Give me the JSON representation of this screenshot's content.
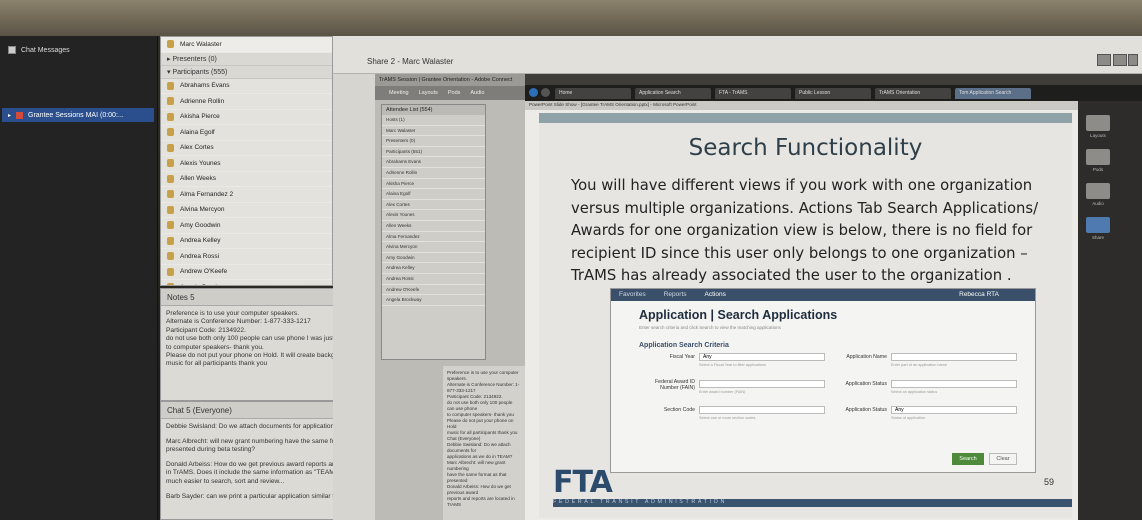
{
  "left_panel": {
    "chat_messages_label": "Chat Messages",
    "session_label": "Grantee Sessions MAI (0:00:..."
  },
  "participants": {
    "presenter": "Marc Walaster",
    "presenters_header": "Presenters (0)",
    "participants_header": "Participants (555)",
    "items": [
      "Abrahams Evans",
      "Adrienne Rollin",
      "Akisha Pierce",
      "Alaina Egolf",
      "Alex Cortes",
      "Alexis Younes",
      "Allen Weeks",
      "Alma Fernandez 2",
      "Alvina Mercyon",
      "Amy Goodwin",
      "Andrea Kelley",
      "Andrea Rossi",
      "Andrew O'Keefe",
      "Angela Brockway"
    ]
  },
  "notes": {
    "title": "Notes 5",
    "lines": [
      "Preference is to use your computer speakers.",
      "Alternate is Conference Number: 1-877-333-1217",
      "Participant Code: 2134922.",
      "do not use both only 100 people can use phone I was just informed",
      "to computer speakers- thank you.",
      "Please do not put your phone on Hold. It will create background",
      "music for all participants thank you"
    ]
  },
  "chat": {
    "title": "Chat 5 (Everyone)",
    "messages": [
      "Debbie Swisland: Do we attach documents for applications as we do in TEAM?",
      "Marc Albrecht: will new grant numbering have the same format as that presented during beta testing?",
      "Donald Arbeiss: How do we get previous award reports and reports are located in TrAMS. Does it include the same information as \"TEAM\" it appears to be much easier to search, sort and review...",
      "Barb Sayder: can we print a particular application similar to \"TEAM"
    ]
  },
  "share": {
    "title": "Share 2 - Marc Walaster"
  },
  "inner_app": {
    "window_title": "TrAMS Session | Grantee Orientation - Adobe Connect",
    "toolbar": [
      "Meeting",
      "Layouts",
      "Pods",
      "Audio"
    ],
    "list_title": "Attendee List (554)",
    "list_items": [
      "Hosts (1)",
      "Marc Walaster",
      "Presenters (0)",
      "Participants (551)",
      "Abrahams Evans",
      "Adrienne Rollin",
      "Akisha Pierce",
      "Alaina Egolf",
      "Alex Cortes",
      "Alexis Younes",
      "Allen Weeks",
      "Alma Fernandez",
      "Alvina Mercyon",
      "Amy Goodwin",
      "Andrea Kelley",
      "Andrea Rossi",
      "Andrew O'Keefe",
      "Angela Brockway"
    ],
    "chat_lines": [
      "Preference is to use your computer speakers.",
      "Alternate is Conference Number: 1-877-333-1217",
      "Participant Code: 2134922.",
      "do not use both only 100 people can use phone",
      "to computer speakers- thank you",
      "Please do not put your phone on Hold",
      "music for all participants thank you",
      "",
      "Chat (Everyone)",
      "Debbie Swisland: Do we attach documents for",
      "applications as we do in TEAM?",
      "Marc Albrecht: will new grant numbering",
      "have the same format as that presented",
      "Donald Arbeiss: How do we get previous award",
      "reports and reports are located in TrAMS"
    ]
  },
  "browser": {
    "tabs": [
      "Home",
      "Application Search",
      "FTA - TrAMS",
      "Public Lesson",
      "TrAMS Orientation",
      "Tom Application Search"
    ],
    "window_title": "PowerPoint Slide Show - [Grantee TrAMS Orientation.pptx] - Microsoft PowerPoint"
  },
  "slide": {
    "title": "Search Functionality",
    "body": "You will have different views if you work with one organization versus multiple organizations.  Actions Tab Search Applications/ Awards for one organization view is below, there is no field for recipient ID since this user only belongs to one organization – TrAMS has already associated the user to the organization .",
    "number": "59",
    "logo": "FTA",
    "logo_sub": "FEDERAL TRANSIT ADMINISTRATION"
  },
  "screenshot": {
    "nav": [
      "Favorites",
      "Reports",
      "Actions"
    ],
    "user": "Rebecca RTA",
    "heading": "Application | Search Applications",
    "subheading": "Enter search criteria and click Search to view the matching applications",
    "section": "Application Search Criteria",
    "fields": [
      {
        "label": "Fiscal Year",
        "value": "Any",
        "hint": "Select a Fiscal Year to filter applications"
      },
      {
        "label": "Application Name",
        "value": "",
        "hint": "Enter part of an application name"
      },
      {
        "label": "Federal Award ID Number (FAIN)",
        "value": "",
        "hint": "Enter award number (FAIN)"
      },
      {
        "label": "Application Status",
        "value": "",
        "hint": "Select an application status"
      },
      {
        "label": "Section Code",
        "value": "",
        "hint": "Select one or more section codes"
      },
      {
        "label": "Application Status",
        "value": "Any",
        "hint": "Status of application"
      }
    ],
    "search_label": "Search",
    "clear_label": "Clear"
  },
  "right_sidebar": {
    "labels": [
      "Layouts",
      "Pods",
      "Audio",
      "Share"
    ]
  }
}
